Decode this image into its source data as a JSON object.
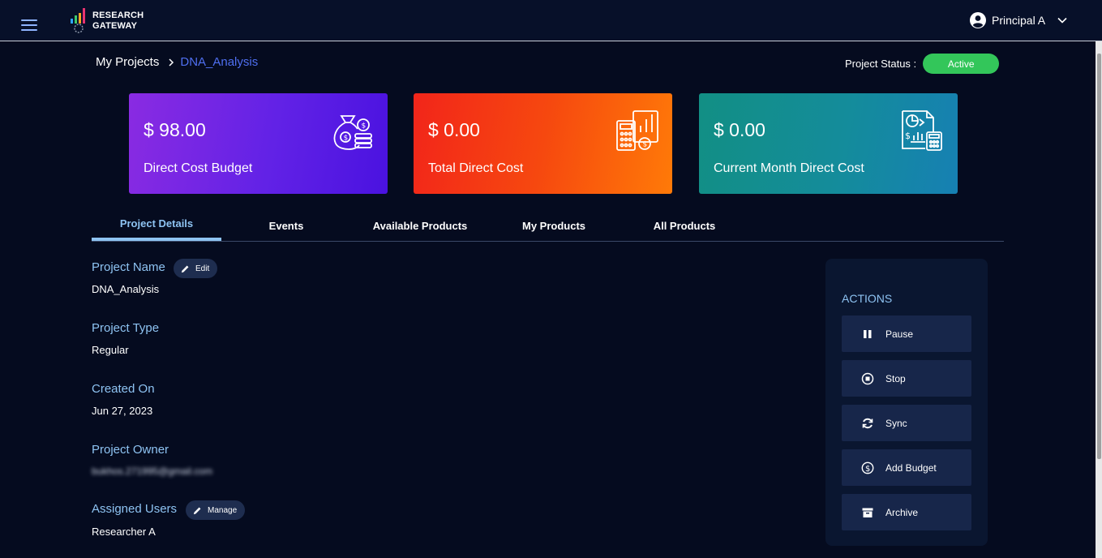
{
  "brand": {
    "line1": "RESEARCH",
    "line2": "GATEWAY"
  },
  "user": {
    "name": "Principal A"
  },
  "breadcrumb": {
    "root": "My Projects",
    "current": "DNA_Analysis"
  },
  "status": {
    "label": "Project Status :",
    "value": "Active",
    "color": "#33c65a"
  },
  "cards": [
    {
      "value": "$ 98.00",
      "label": "Direct Cost Budget",
      "icon": "money-bag-icon"
    },
    {
      "value": "$ 0.00",
      "label": "Total Direct Cost",
      "icon": "calculator-chart-icon"
    },
    {
      "value": "$ 0.00",
      "label": "Current Month Direct Cost",
      "icon": "report-calculator-icon"
    }
  ],
  "tabs": [
    "Project Details",
    "Events",
    "Available Products",
    "My Products",
    "All Products"
  ],
  "details": {
    "name_label": "Project Name",
    "edit_label": "Edit",
    "name_value": "DNA_Analysis",
    "type_label": "Project Type",
    "type_value": "Regular",
    "created_label": "Created On",
    "created_value": "Jun 27, 2023",
    "owner_label": "Project Owner",
    "owner_value": "bukhos.271995@gmail.com",
    "users_label": "Assigned Users",
    "manage_label": "Manage",
    "users_value": "Researcher A"
  },
  "actions": {
    "title": "ACTIONS",
    "items": [
      {
        "label": "Pause",
        "icon": "pause-icon"
      },
      {
        "label": "Stop",
        "icon": "stop-icon"
      },
      {
        "label": "Sync",
        "icon": "sync-icon"
      },
      {
        "label": "Add Budget",
        "icon": "dollar-circle-icon"
      },
      {
        "label": "Archive",
        "icon": "archive-icon"
      }
    ]
  },
  "colors": {
    "accent": "#8ec3f2",
    "link": "#4f6ff0",
    "background": "#050b1f"
  }
}
